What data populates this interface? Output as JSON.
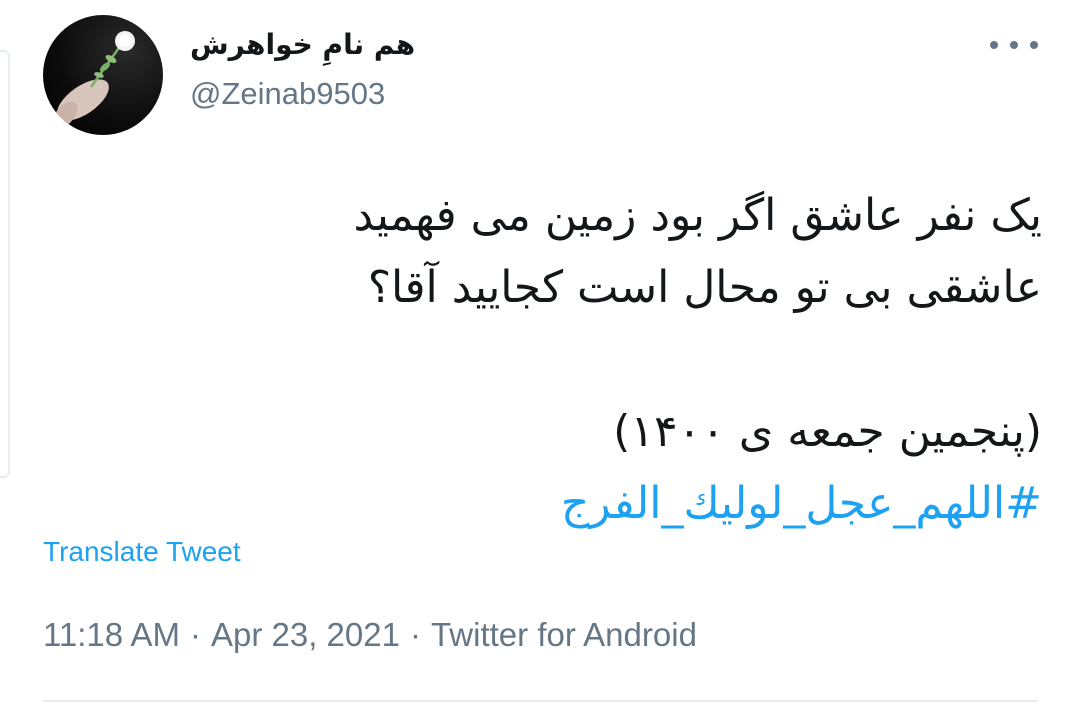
{
  "tweet": {
    "author": {
      "display_name": "هم نامِ خواهرش",
      "handle": "@Zeinab9503",
      "avatar_icon": "avatar-hand-flower"
    },
    "more_icon": "more-options-icon",
    "body_lines": [
      "یک نفر عاشق اگر بود زمین می فهمید",
      "عاشقی بی تو محال است کجایید آقا؟",
      "",
      "(پنجمین جمعه ی ۱۴۰۰)"
    ],
    "hashtag": "#اللهم_عجل_لوليك_الفرج",
    "translate_label": "Translate Tweet",
    "time": "11:18 AM",
    "separator": "·",
    "date": "Apr 23, 2021",
    "source": "Twitter for Android"
  },
  "colors": {
    "text": "#14171a",
    "secondary": "#657786",
    "link": "#1da1f2",
    "divider": "#e6ecf0"
  }
}
